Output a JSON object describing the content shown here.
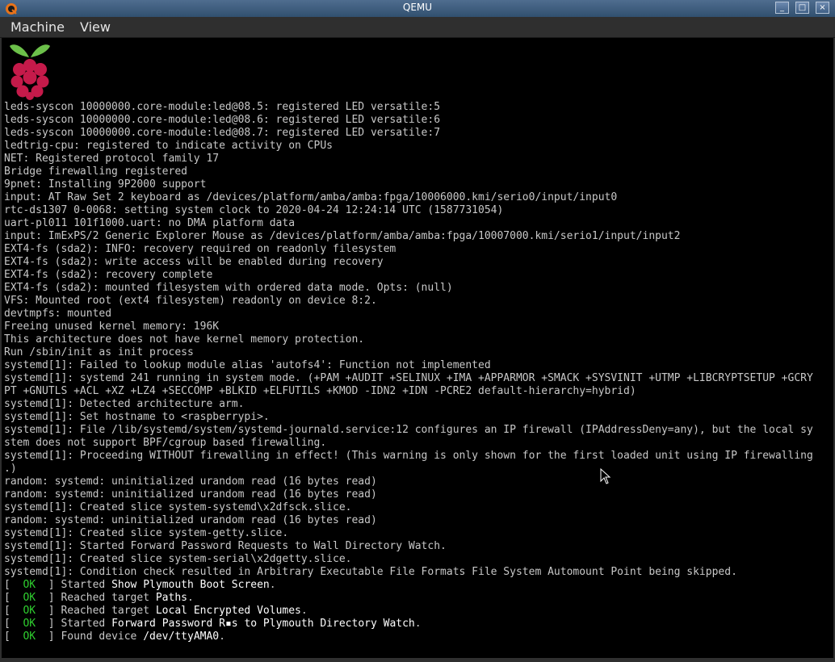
{
  "window": {
    "title": "QEMU",
    "minimize_symbol": "_",
    "maximize_symbol": "□",
    "close_symbol": "×"
  },
  "menu": {
    "machine": "Machine",
    "view": "View"
  },
  "console": {
    "plain_lines": [
      "leds-syscon 10000000.core-module:led@08.5: registered LED versatile:5",
      "leds-syscon 10000000.core-module:led@08.6: registered LED versatile:6",
      "leds-syscon 10000000.core-module:led@08.7: registered LED versatile:7",
      "ledtrig-cpu: registered to indicate activity on CPUs",
      "NET: Registered protocol family 17",
      "Bridge firewalling registered",
      "9pnet: Installing 9P2000 support",
      "input: AT Raw Set 2 keyboard as /devices/platform/amba/amba:fpga/10006000.kmi/serio0/input/input0",
      "rtc-ds1307 0-0068: setting system clock to 2020-04-24 12:24:14 UTC (1587731054)",
      "uart-pl011 101f1000.uart: no DMA platform data",
      "input: ImExPS/2 Generic Explorer Mouse as /devices/platform/amba/amba:fpga/10007000.kmi/serio1/input/input2",
      "EXT4-fs (sda2): INFO: recovery required on readonly filesystem",
      "EXT4-fs (sda2): write access will be enabled during recovery",
      "EXT4-fs (sda2): recovery complete",
      "EXT4-fs (sda2): mounted filesystem with ordered data mode. Opts: (null)",
      "VFS: Mounted root (ext4 filesystem) readonly on device 8:2.",
      "devtmpfs: mounted",
      "Freeing unused kernel memory: 196K",
      "This architecture does not have kernel memory protection.",
      "Run /sbin/init as init process",
      "systemd[1]: Failed to lookup module alias 'autofs4': Function not implemented",
      "systemd[1]: systemd 241 running in system mode. (+PAM +AUDIT +SELINUX +IMA +APPARMOR +SMACK +SYSVINIT +UTMP +LIBCRYPTSETUP +GCRY",
      "PT +GNUTLS +ACL +XZ +LZ4 +SECCOMP +BLKID +ELFUTILS +KMOD -IDN2 +IDN -PCRE2 default-hierarchy=hybrid)",
      "systemd[1]: Detected architecture arm.",
      "systemd[1]: Set hostname to <raspberrypi>.",
      "systemd[1]: File /lib/systemd/system/systemd-journald.service:12 configures an IP firewall (IPAddressDeny=any), but the local sy",
      "stem does not support BPF/cgroup based firewalling.",
      "systemd[1]: Proceeding WITHOUT firewalling in effect! (This warning is only shown for the first loaded unit using IP firewalling",
      ".)",
      "random: systemd: uninitialized urandom read (16 bytes read)",
      "random: systemd: uninitialized urandom read (16 bytes read)",
      "systemd[1]: Created slice system-systemd\\x2dfsck.slice.",
      "random: systemd: uninitialized urandom read (16 bytes read)",
      "systemd[1]: Created slice system-getty.slice.",
      "systemd[1]: Started Forward Password Requests to Wall Directory Watch.",
      "systemd[1]: Created slice system-serial\\x2dgetty.slice.",
      "systemd[1]: Condition check resulted in Arbitrary Executable File Formats File System Automount Point being skipped."
    ],
    "status_lines": [
      {
        "open": "[  ",
        "ok": "OK",
        "close": "  ] ",
        "verb": "Started ",
        "target": "Show Plymouth Boot Screen",
        "end": "."
      },
      {
        "open": "[  ",
        "ok": "OK",
        "close": "  ] ",
        "verb": "Reached target ",
        "target": "Paths",
        "end": "."
      },
      {
        "open": "[  ",
        "ok": "OK",
        "close": "  ] ",
        "verb": "Reached target ",
        "target": "Local Encrypted Volumes",
        "end": "."
      },
      {
        "open": "[  ",
        "ok": "OK",
        "close": "  ] ",
        "verb": "Started ",
        "target": "Forward Password R▪s to Plymouth Directory Watch",
        "end": "."
      },
      {
        "open": "[  ",
        "ok": "OK",
        "close": "  ] ",
        "verb": "Found device ",
        "target": "/dev/ttyAMA0",
        "end": "."
      }
    ]
  },
  "colors": {
    "ok_green": "#2fcf2f",
    "console_text": "#c8c8c8",
    "highlight_text": "#ffffff",
    "raspberry_red": "#c51a4a",
    "leaf_green": "#6cc04a"
  },
  "icons": {
    "app": "qemu-icon",
    "logo": "raspberry-pi-logo",
    "pointer": "mouse-pointer-icon"
  }
}
